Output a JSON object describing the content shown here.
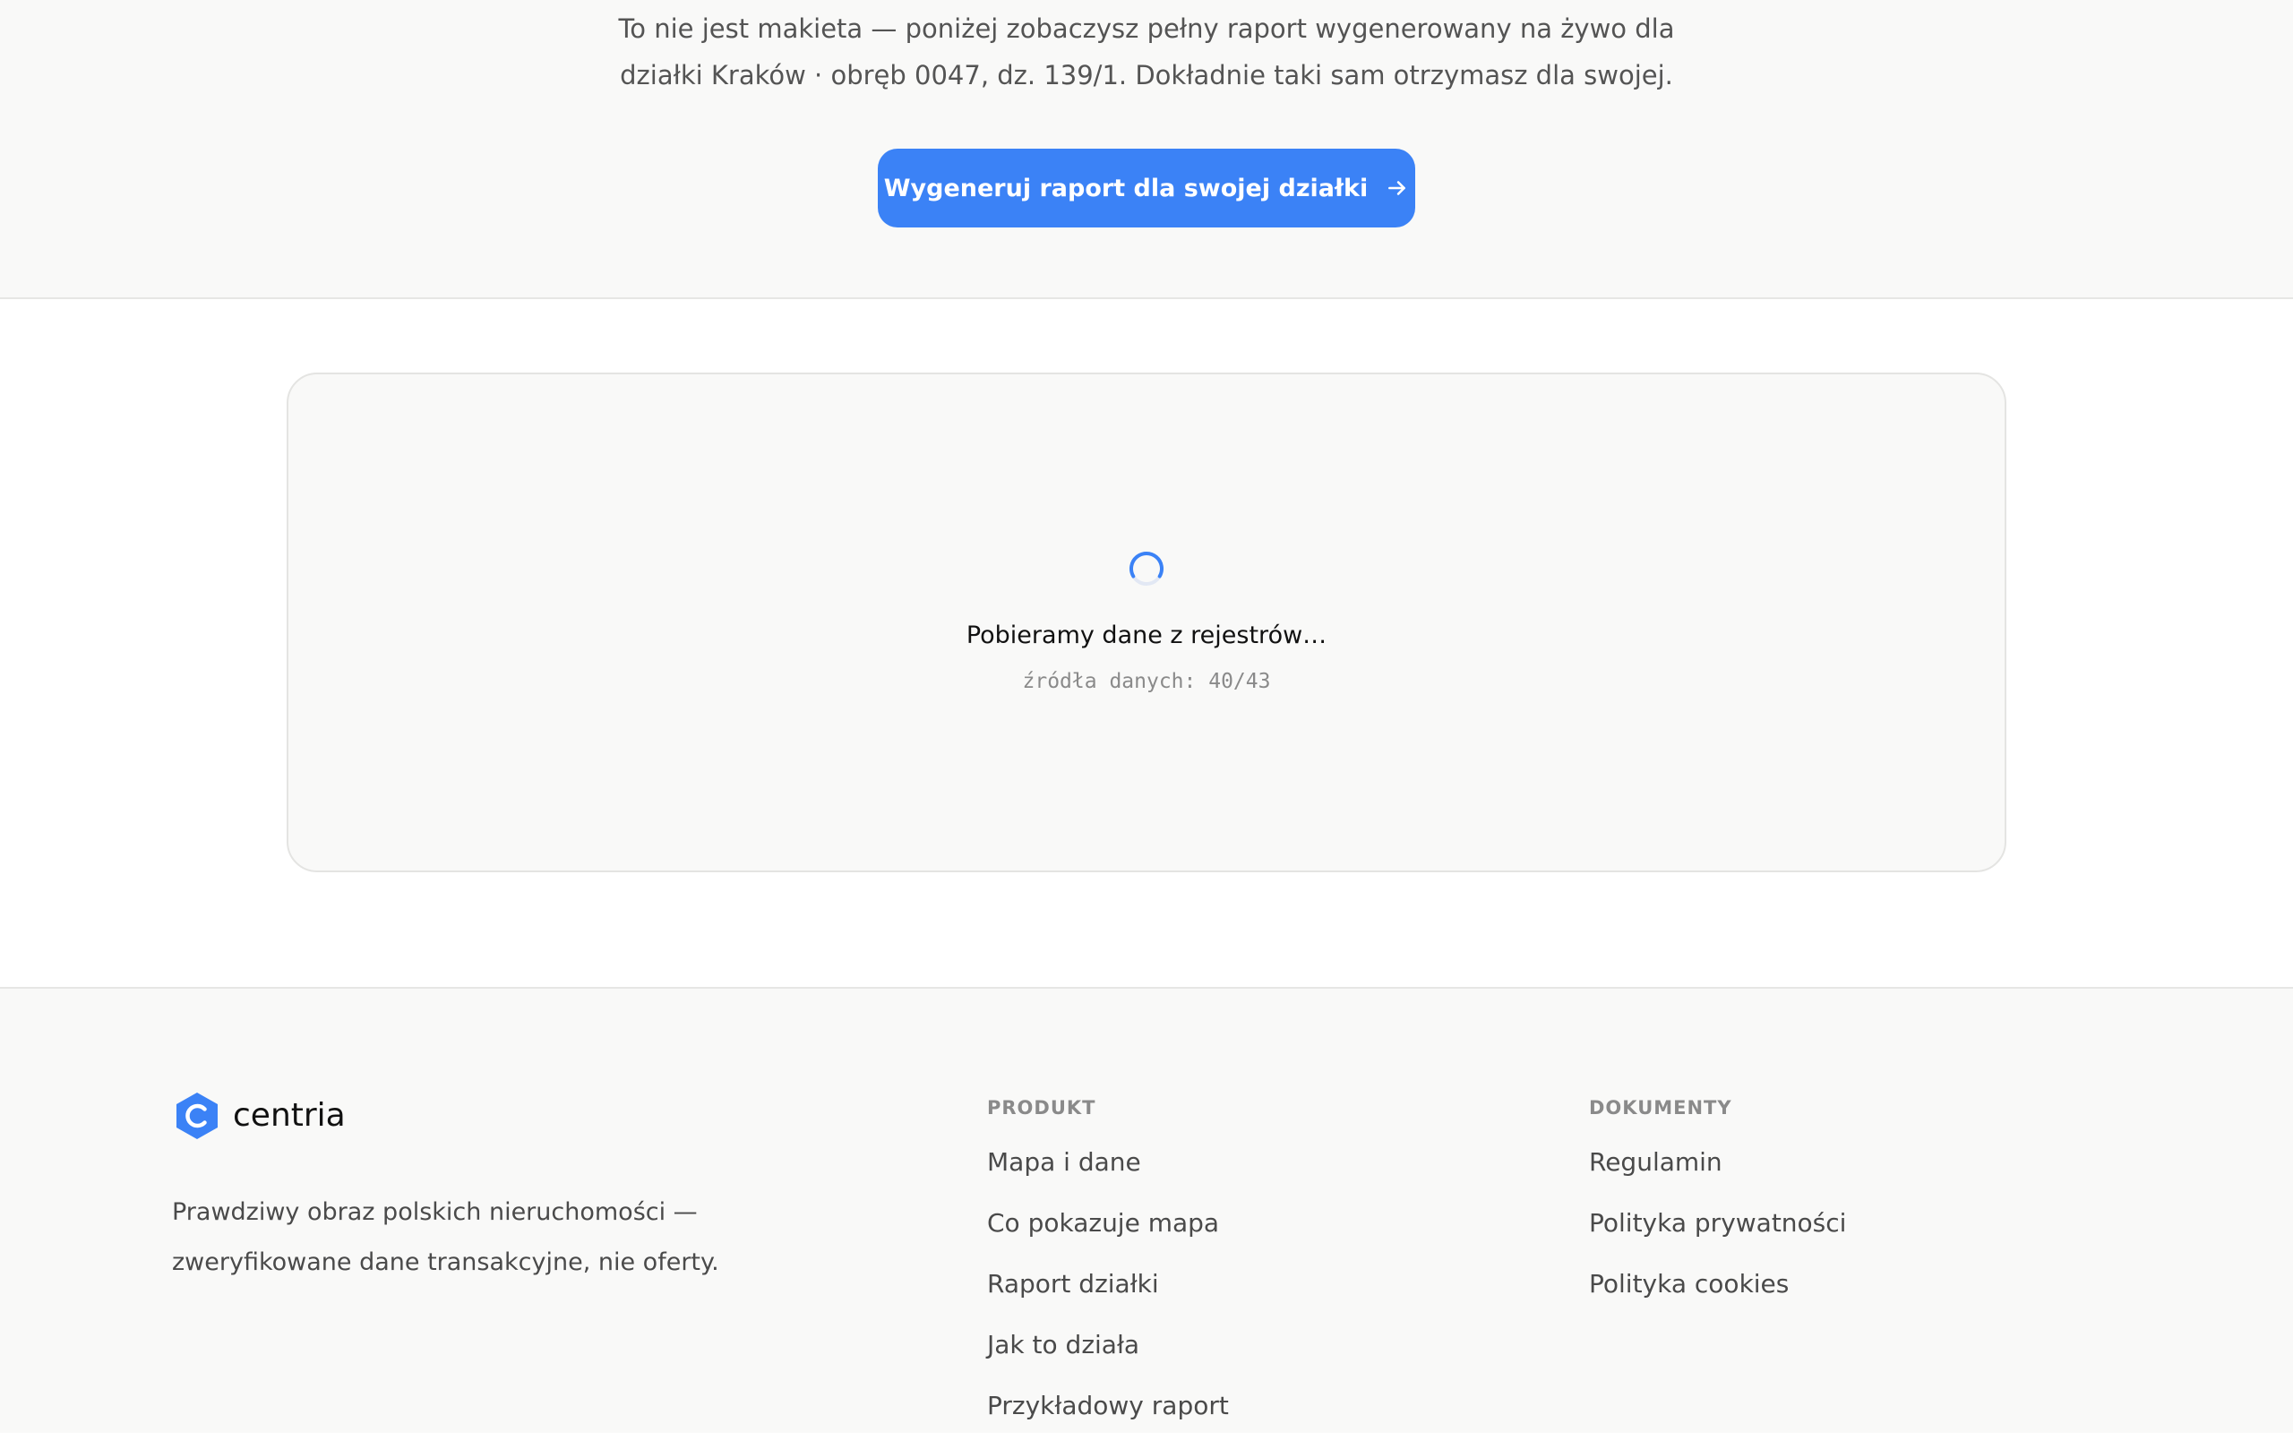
{
  "hero": {
    "description_line1": "To nie jest makieta — poniżej zobaczysz pełny raport wygenerowany na żywo dla",
    "description_line2": "działki Kraków · obręb 0047, dz. 139/1. Dokładnie taki sam otrzymasz dla swojej.",
    "cta_label": "Wygeneruj raport dla swojej działki",
    "cta_icon": "arrow-right-icon"
  },
  "report": {
    "loading_icon": "spinner-icon",
    "loading_title": "Pobieramy dane z rejestrów…",
    "sources_counter": "źródła danych: 40/43"
  },
  "footer": {
    "brand_name": "centria",
    "brand_logo_icon": "centria-hexagon-logo",
    "tagline_line1": "Prawdziwy obraz polskich nieruchomości —",
    "tagline_line2": "zweryfikowane dane transakcyjne, nie oferty.",
    "columns": [
      {
        "heading": "PRODUKT",
        "links": [
          "Mapa i dane",
          "Co pokazuje mapa",
          "Raport działki",
          "Jak to działa",
          "Przykładowy raport"
        ]
      },
      {
        "heading": "DOKUMENTY",
        "links": [
          "Regulamin",
          "Polityka prywatności",
          "Polityka cookies"
        ]
      }
    ]
  },
  "colors": {
    "accent": "#3b82f6",
    "page_background": "#f9f9f8",
    "text_muted": "#545454"
  }
}
